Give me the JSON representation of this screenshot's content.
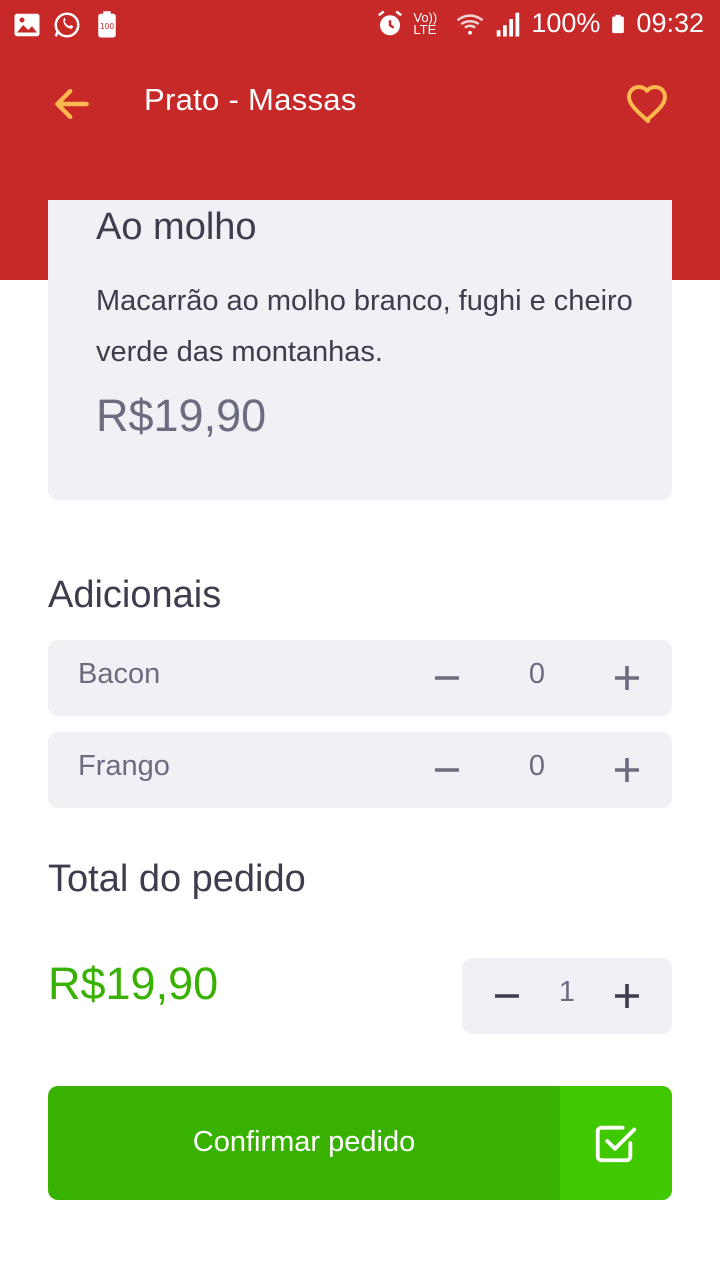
{
  "status_bar": {
    "battery": "100%",
    "time": "09:32",
    "network": "Vo)) LTE"
  },
  "header": {
    "title": "Prato - Massas",
    "back_icon": "arrow-left-icon",
    "favorite_icon": "heart-icon"
  },
  "food": {
    "name": "Ao molho",
    "description": "Macarrão ao molho branco, fughi e cheiro verde das montanhas.",
    "price": "R$19,90"
  },
  "extras": {
    "title": "Adicionais",
    "items": [
      {
        "name": "Bacon",
        "quantity": "0"
      },
      {
        "name": "Frango",
        "quantity": "0"
      }
    ]
  },
  "total": {
    "title": "Total do pedido",
    "value": "R$19,90",
    "quantity": "1"
  },
  "confirm": {
    "label": "Confirmar pedido",
    "icon": "check-square-icon"
  },
  "colors": {
    "header_red": "#c72828",
    "accent_orange": "#ffb84d",
    "card_bg": "#f0f0f5",
    "text_dark": "#3d3d4d",
    "text_muted": "#6c6c80",
    "green": "#39b100",
    "green_light": "#41c900"
  }
}
